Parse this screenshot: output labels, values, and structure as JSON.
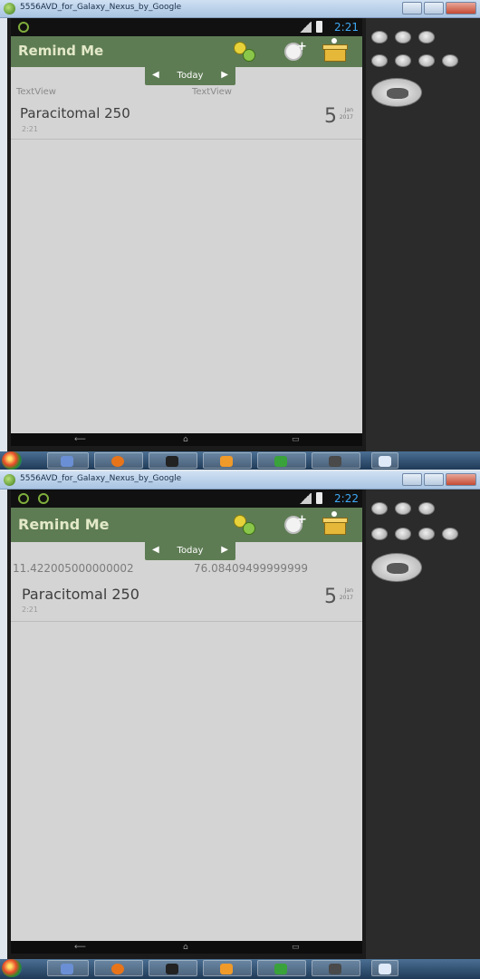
{
  "screens": [
    {
      "window_title": "5556AVD_for_Galaxy_Nexus_by_Google",
      "status_time": "2:21",
      "app_title": "Remind Me",
      "date_nav_label": "Today",
      "left_text": "TextView",
      "right_text": "TextView",
      "reminder": {
        "name": "Paracitomal 250",
        "time": "2:21",
        "day": "5",
        "month": "Jan",
        "year": "2017"
      }
    },
    {
      "window_title": "5556AVD_for_Galaxy_Nexus_by_Google",
      "status_time": "2:22",
      "app_title": "Remind Me",
      "date_nav_label": "Today",
      "left_text": "11.422005000000002",
      "right_text": "76.08409499999999",
      "reminder": {
        "name": "Paracitomal 250",
        "time": "2:21",
        "day": "5",
        "month": "Jan",
        "year": "2017"
      }
    }
  ],
  "icons": {
    "app_icon": "android-icon",
    "add_pills": "pills-icon",
    "add_alarm": "alarm-clock-plus-icon",
    "pill_box": "pill-box-icon",
    "prev": "left-arrow-icon",
    "next": "right-arrow-icon"
  },
  "colors": {
    "action_bar": "#5e7c54",
    "app_title": "#e3e9c8",
    "status_time": "#3fa9f5",
    "list_background": "#d4d4d4"
  }
}
